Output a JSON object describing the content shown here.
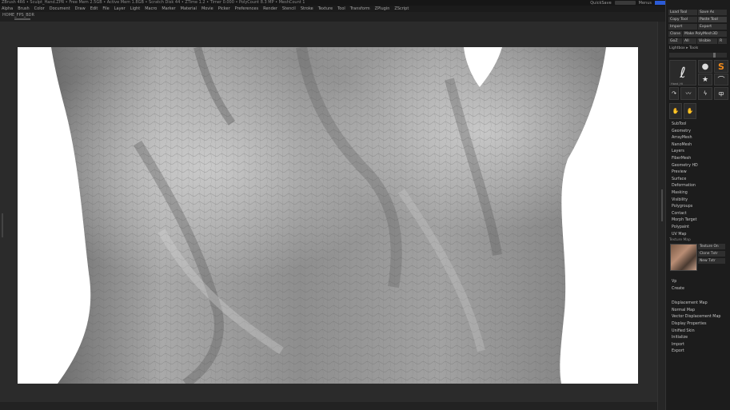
{
  "titlebar": {
    "text": "ZBrush 4R6 • Sculpt_Hand.ZPR • Free Mem 2.5GB • Active Mem 1.8GB • Scratch Disk 44 • ZTime 1.2 • Timer 0.000 • PolyCount 8.3 MP • MeshCount 1"
  },
  "top_right": {
    "items": [
      "QuickSave",
      "See-through",
      "Menus",
      "DefaultZScript"
    ]
  },
  "menubar": {
    "items": [
      "Alpha",
      "Brush",
      "Color",
      "Document",
      "Draw",
      "Edit",
      "File",
      "Layer",
      "Light",
      "Macro",
      "Marker",
      "Material",
      "Movie",
      "Picker",
      "Preferences",
      "Render",
      "Stencil",
      "Stroke",
      "Texture",
      "Tool",
      "Transform",
      "ZPlugin",
      "ZScript"
    ]
  },
  "subbar": {
    "label": "HOME_FPS_BDR"
  },
  "panel": {
    "top_buttons": [
      {
        "label": "Load Tool",
        "active": false
      },
      {
        "label": "Save As",
        "active": false
      },
      {
        "label": "Copy Tool",
        "active": false
      },
      {
        "label": "Paste Tool",
        "active": true
      },
      {
        "label": "Import",
        "active": false
      },
      {
        "label": "Export",
        "active": false
      },
      {
        "label": "Clone",
        "active": false
      },
      {
        "label": "Make PolyMesh3D",
        "active": false
      },
      {
        "label": "GoZ",
        "active": false
      },
      {
        "label": "All",
        "active": false
      },
      {
        "label": "Visible",
        "active": false
      },
      {
        "label": "R",
        "active": false
      }
    ],
    "lightbox_label": "Lightbox ▸ Tools",
    "tools": [
      {
        "name": "hand-tool",
        "glyph": "ℓ",
        "caption": "Hand_Hi"
      },
      {
        "name": "sphere-tool",
        "glyph": "●",
        "caption": "Sphere3D"
      },
      {
        "name": "simple-brush-tool",
        "glyph": "S",
        "caption": "SimpleBrush"
      },
      {
        "name": "star-tool",
        "glyph": "★",
        "caption": "Star"
      },
      {
        "name": "figure-tool",
        "glyph": "⌒",
        "caption": "Hand"
      }
    ],
    "subtools": [
      "SubTool",
      "Geometry",
      "ArrayMesh",
      "NanoMesh",
      "Layers",
      "FiberMesh",
      "Geometry HD",
      "Preview",
      "Surface",
      "Deformation",
      "Masking",
      "Visibility",
      "Polygroups",
      "Contact",
      "Morph Target",
      "Polypaint",
      "UV Map"
    ],
    "texture_map": {
      "title": "Texture Map",
      "buttons": [
        "Texture On",
        "Clone Txtr",
        "New Txtr"
      ]
    },
    "lower_items_a": [
      "Vp",
      "Create"
    ],
    "lower_items_b": [
      "Displacement Map",
      "Normal Map",
      "Vector Displacement Map",
      "Display Properties",
      "Unified Skin",
      "Initialize",
      "Import",
      "Export"
    ]
  },
  "canvas": {
    "background_color": "#ffffff",
    "model": "sculpted-hand-skin"
  }
}
